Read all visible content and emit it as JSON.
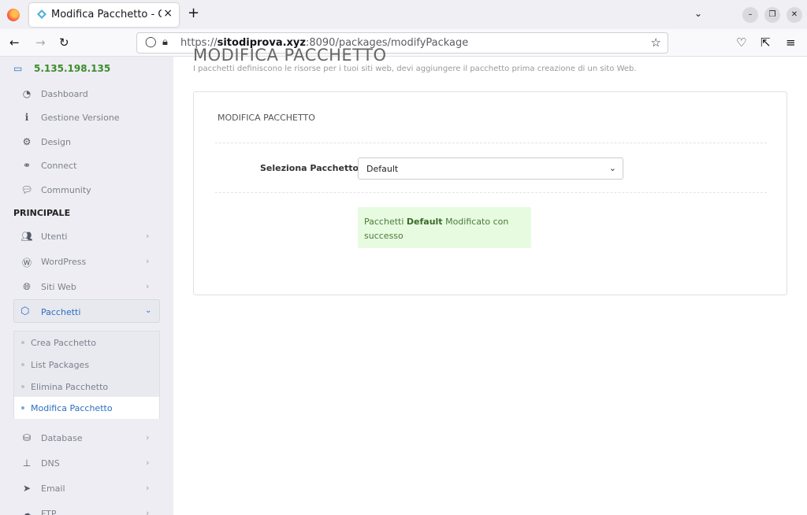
{
  "browser": {
    "tab_title": "Modifica Pacchetto - Cyb",
    "url_prefix": "https://",
    "url_host": "sitodiprova.xyz",
    "url_path": ":8090/packages/modifyPackage"
  },
  "sidebar": {
    "ip": "5.135.198.135",
    "top_items": [
      {
        "label": "Dashboard"
      },
      {
        "label": "Gestione Versione"
      },
      {
        "label": "Design"
      },
      {
        "label": "Connect"
      },
      {
        "label": "Community"
      }
    ],
    "section_label": "PRINCIPALE",
    "main_items": [
      {
        "label": "Utenti"
      },
      {
        "label": "WordPress"
      },
      {
        "label": "Siti Web"
      }
    ],
    "active_item": "Pacchetti",
    "submenu": [
      {
        "label": "Crea Pacchetto"
      },
      {
        "label": "List Packages"
      },
      {
        "label": "Elimina Pacchetto"
      },
      {
        "label": "Modifica Pacchetto"
      }
    ],
    "bottom_items": [
      {
        "label": "Database"
      },
      {
        "label": "DNS"
      },
      {
        "label": "Email"
      },
      {
        "label": "FTP"
      }
    ]
  },
  "page": {
    "heading": "MODIFICA PACCHETTO",
    "subtitle": "I pacchetti definiscono le risorse per i tuoi siti web, devi aggiungere il pacchetto prima creazione di un sito Web.",
    "card_title": "MODIFICA PACCHETTO",
    "select_label": "Seleziona Pacchetto",
    "select_value": "Default",
    "alert_prefix": "Pacchetti",
    "alert_name": "Default",
    "alert_suffix": "Modificato con successo"
  }
}
